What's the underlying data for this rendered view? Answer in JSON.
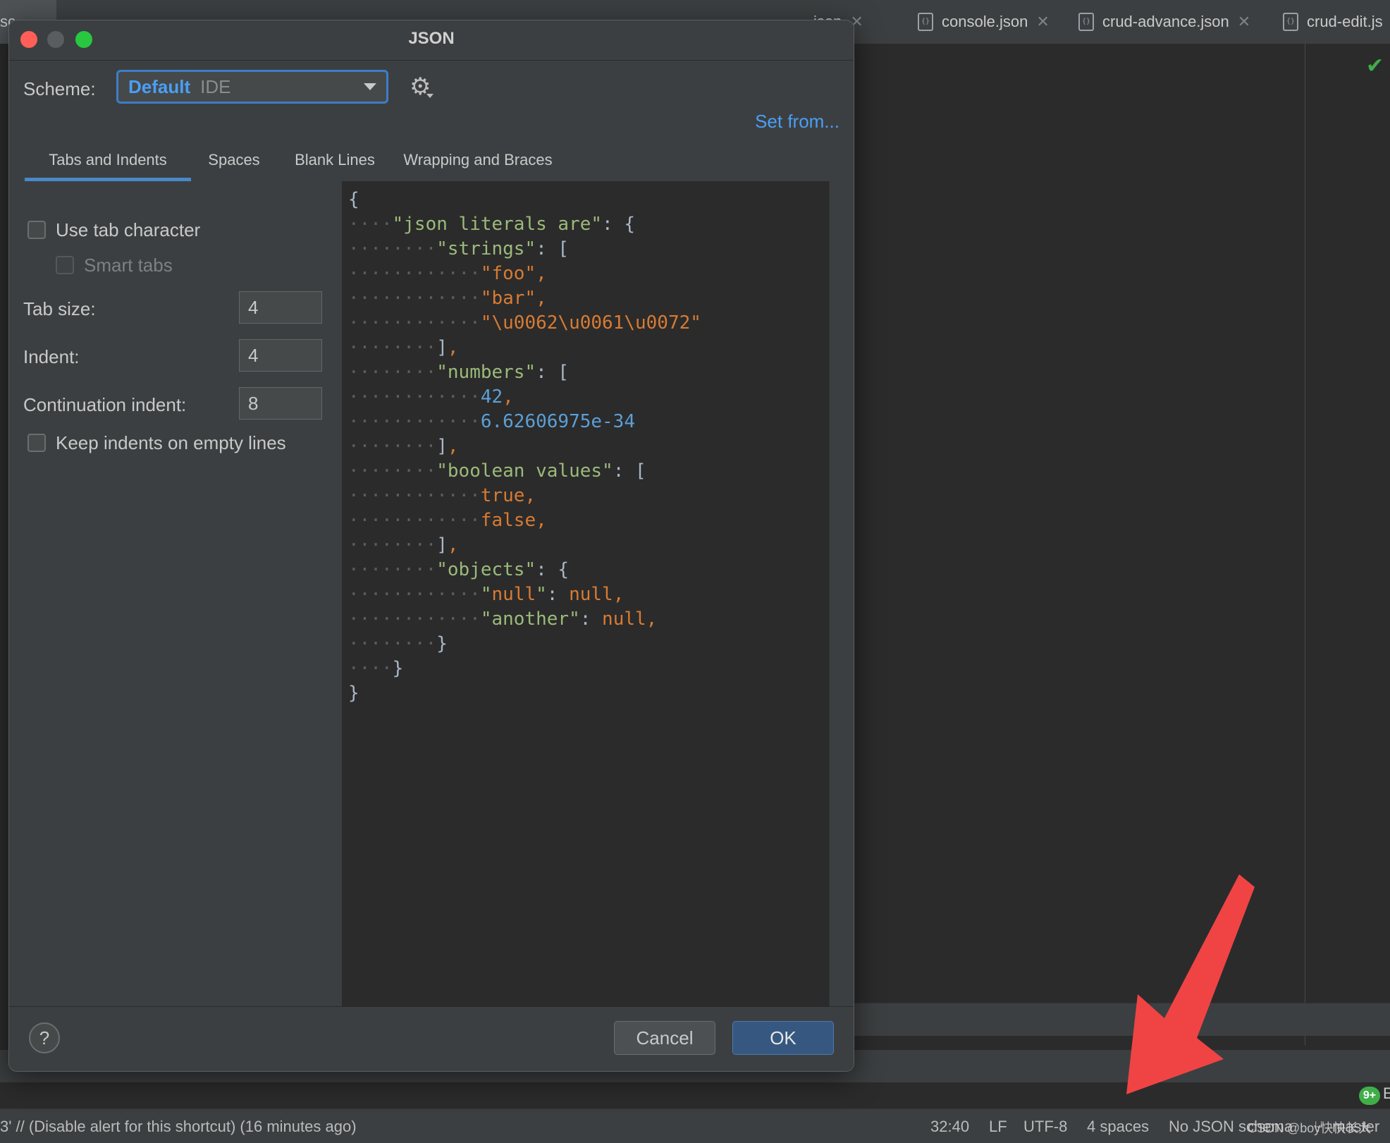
{
  "ide": {
    "tab_fragment_left": "sc",
    "tabs": [
      {
        "label": "json"
      },
      {
        "label": "console.json"
      },
      {
        "label": "crud-advance.json"
      },
      {
        "label": "crud-edit.js"
      }
    ],
    "tab_close": "✕",
    "badge": "9+",
    "badge_suffix": "E"
  },
  "dialog": {
    "title": "JSON",
    "scheme_label": "Scheme:",
    "scheme_name": "Default",
    "scheme_sub": "IDE",
    "set_from": "Set from...",
    "tabs": [
      "Tabs and Indents",
      "Spaces",
      "Blank Lines",
      "Wrapping and Braces"
    ],
    "active_tab": "Tabs and Indents",
    "settings": {
      "use_tab_character": {
        "label": "Use tab character",
        "checked": false
      },
      "smart_tabs": {
        "label": "Smart tabs",
        "checked": false,
        "enabled": false
      },
      "tab_size": {
        "label": "Tab size:",
        "value": "4"
      },
      "indent": {
        "label": "Indent:",
        "value": "4"
      },
      "continuation_indent": {
        "label": "Continuation indent:",
        "value": "8"
      },
      "keep_indents": {
        "label": "Keep indents on empty lines",
        "checked": false
      }
    },
    "help": "?",
    "cancel": "Cancel",
    "ok": "OK"
  },
  "preview_code": [
    "{",
    "    \"json literals are\": {",
    "        \"strings\": [",
    "            \"foo\",",
    "            \"bar\",",
    "            \"\\u0062\\u0061\\u0072\"",
    "        ],",
    "        \"numbers\": [",
    "            42,",
    "            6.62606975e-34",
    "        ],",
    "        \"boolean values\": [",
    "            true,",
    "            false,",
    "        ],",
    "        \"objects\": {",
    "            \"null\": null,",
    "            \"another\": null,",
    "        }",
    "    }",
    "}"
  ],
  "statusbar": {
    "message": "3' // (Disable alert for this shortcut) (16 minutes ago)",
    "position": "32:40",
    "line_sep": "LF",
    "encoding": "UTF-8",
    "indent": "4 spaces",
    "schema": "No JSON schema",
    "branch": "master",
    "watermark": "CSDN @boy快快长大"
  },
  "colors": {
    "accent": "#4a9ff5",
    "key": "#9cba7a",
    "string": "#d87b33",
    "number": "#5c9fd6",
    "arrow": "#f04444"
  }
}
